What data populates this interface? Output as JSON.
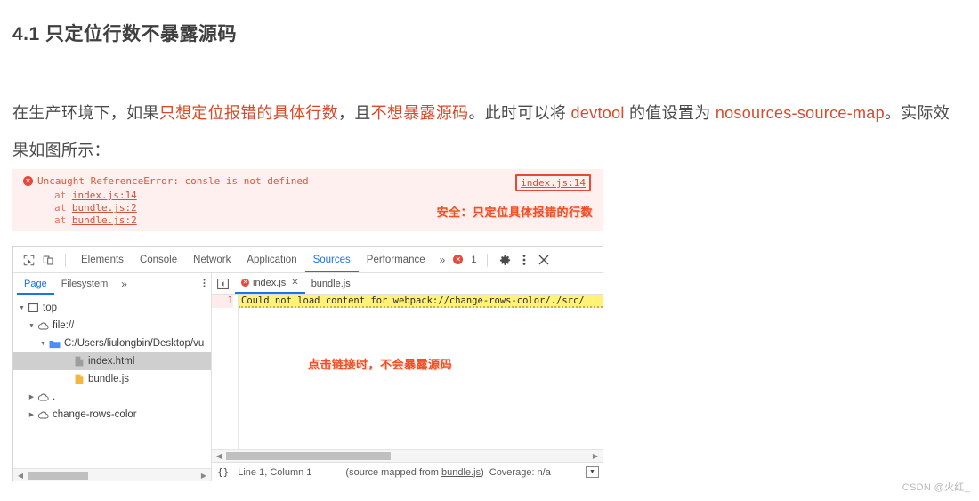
{
  "article": {
    "heading": "4.1 只定位行数不暴露源码",
    "paragraph": {
      "seg1": "在生产环境下，如果",
      "seg2_red": "只想定位报错的具体行数",
      "seg3": "，且",
      "seg4_red": "不想暴露源码",
      "seg5": "。此时可以将 ",
      "seg6_red": "devtool",
      "seg7": " 的值设置为 ",
      "seg8_red": "nosources-source-map",
      "seg9": "。实际效果如图所示："
    }
  },
  "console_block": {
    "error_icon": "error-circle-icon",
    "error_message": "Uncaught ReferenceError: consle is not defined",
    "source_link": "index.js:14",
    "stack": [
      {
        "at": "at",
        "link": "index.js:14"
      },
      {
        "at": "at",
        "link": "bundle.js:2"
      },
      {
        "at": "at",
        "link": "bundle.js:2"
      }
    ],
    "annotation": "安全：只定位具体报错的行数"
  },
  "devtools": {
    "toolbar": {
      "inspect_icon": "inspect-element-icon",
      "device_icon": "device-toolbar-icon",
      "tabs": [
        {
          "label": "Elements",
          "active": false
        },
        {
          "label": "Console",
          "active": false
        },
        {
          "label": "Network",
          "active": false
        },
        {
          "label": "Application",
          "active": false
        },
        {
          "label": "Sources",
          "active": true
        },
        {
          "label": "Performance",
          "active": false
        }
      ],
      "more_tabs": "»",
      "error_count": "1",
      "settings_icon": "gear-icon",
      "kebab_icon": "more-options-icon",
      "close_icon": "close-icon"
    },
    "navigator": {
      "tabs": [
        {
          "label": "Page",
          "active": true
        },
        {
          "label": "Filesystem",
          "active": false
        }
      ],
      "more": "»",
      "kebab": "⋮",
      "tree": [
        {
          "indent": 0,
          "twisty": "▼",
          "icon": "frame-icon",
          "label": "top",
          "selected": false
        },
        {
          "indent": 1,
          "twisty": "▼",
          "icon": "cloud-icon",
          "label": "file://",
          "selected": false
        },
        {
          "indent": 2,
          "twisty": "▼",
          "icon": "folder-icon",
          "label": "C:/Users/liulongbin/Desktop/vu",
          "selected": false
        },
        {
          "indent": 3,
          "twisty": "",
          "icon": "file-gray-icon",
          "label": "index.html",
          "selected": true
        },
        {
          "indent": 3,
          "twisty": "",
          "icon": "file-js-icon",
          "label": "bundle.js",
          "selected": false
        },
        {
          "indent": 1,
          "twisty": "▶",
          "icon": "cloud-icon",
          "label": ".",
          "selected": false
        },
        {
          "indent": 1,
          "twisty": "▶",
          "icon": "cloud-icon",
          "label": "change-rows-color",
          "selected": false
        }
      ]
    },
    "editor": {
      "panel_toggle_icon": "show-navigator-icon",
      "tabs": [
        {
          "label": "index.js",
          "active": true,
          "has_error": true,
          "closable": true
        },
        {
          "label": "bundle.js",
          "active": false,
          "has_error": false,
          "closable": false
        }
      ],
      "line_number": "1",
      "line_content": "Could not load content for webpack://change-rows-color/./src/",
      "annotation": "点击链接时，不会暴露源码"
    },
    "status_bar": {
      "format_icon": "{}",
      "position": "Line 1, Column 1",
      "source_mapped_prefix": "(source mapped from ",
      "source_mapped_file": "bundle.js",
      "source_mapped_suffix": ")",
      "coverage": "Coverage: n/a",
      "dock_icon": "dock-to-bottom-icon"
    }
  },
  "watermark": "CSDN @火红_",
  "colors": {
    "accent_blue": "#1a73e8",
    "error_red": "#e8483a",
    "annotation_orange": "#f24d24",
    "console_bg": "#fdf0ee",
    "highlight_yellow": "#fff275"
  }
}
